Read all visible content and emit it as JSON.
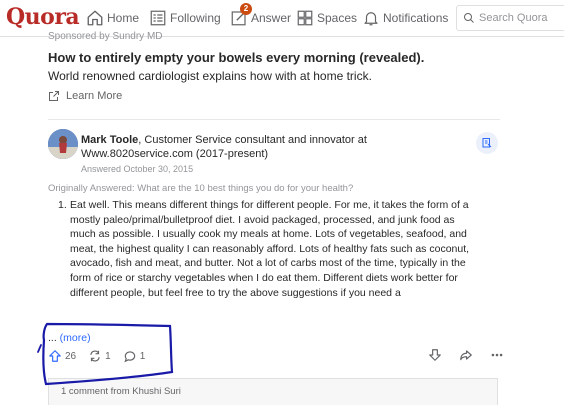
{
  "nav": {
    "logo": "Quora",
    "home": "Home",
    "following": "Following",
    "answer": "Answer",
    "answer_badge": "2",
    "spaces": "Spaces",
    "notifications": "Notifications",
    "search_placeholder": "Search Quora"
  },
  "ad": {
    "sponsored": "Sponsored by Sundry MD",
    "title": "How to entirely empty your bowels every morning (revealed).",
    "subtitle": "World renowned cardiologist explains how with at home trick.",
    "learn_more": "Learn More"
  },
  "answer": {
    "author_name": "Mark Toole",
    "author_cred": ", Customer Service consultant and innovator at Www.8020service.com (2017-present)",
    "answered_date": "Answered October 30, 2015",
    "originally_answered": "Originally Answered: What are the 10 best things you do for your health?",
    "list_number": "1.",
    "body": "Eat well. This means different things for different people. For me, it takes the form of a mostly paleo/primal/bulletproof diet. I avoid packaged, processed, and junk food as much as possible. I usually cook my meals at home. Lots of vegetables, seafood, and meat, the highest quality I can reasonably afford. Lots of healthy fats such as coconut, avocado, fish and meat, and butter. Not a lot of carbs most of the time, typically in the form of rice or starchy vegetables when I do eat them. Different diets work better for different people, but feel free to try the above suggestions if you need a",
    "ellipsis": "... ",
    "more_link": "(more)",
    "upvotes": "26",
    "shares": "1",
    "comments": "1"
  },
  "comments": {
    "summary": "1 comment from Khushi Suri"
  },
  "colors": {
    "brand": "#b92b27",
    "link": "#2e69ff",
    "annotation": "#1a1aa8"
  }
}
